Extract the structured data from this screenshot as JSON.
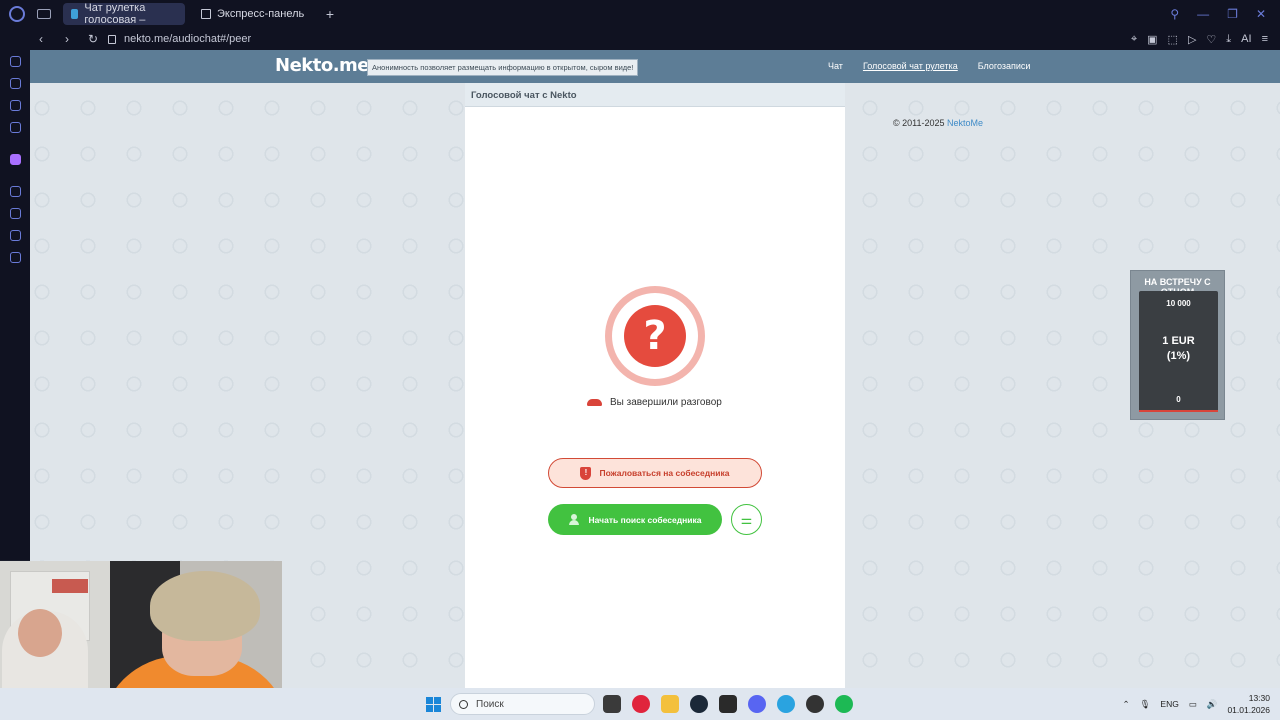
{
  "browser": {
    "tabs": [
      {
        "label": "Чат рулетка голосовая –",
        "active": true
      },
      {
        "label": "Экспресс-панель",
        "active": false
      }
    ],
    "new_tab": "+",
    "url": "nekto.me/audiochat#/peer",
    "ai_label": "AI"
  },
  "site": {
    "logo": "Nekto.me",
    "slogan": "Анонимность позволяет размещать информацию в открытом, сыром виде!",
    "nav": [
      "Чат",
      "Голосовой чат рулетка",
      "Блогозаписи"
    ],
    "copyright_prefix": "© 2011-2025 ",
    "copyright_link": "NektoMe"
  },
  "chat": {
    "header": "Голосовой чат с Nekto",
    "status_symbol": "?",
    "end_message": "Вы завершили разговор",
    "report_label": "Пожаловаться на собеседника",
    "search_label": "Начать поиск собеседника",
    "settings_icon": "sliders-icon"
  },
  "donation": {
    "title": "НА ВСТРЕЧУ С ОТЦОМ",
    "goal": "10 000",
    "amount_line1": "1 EUR",
    "amount_line2": "(1%)",
    "min": "0",
    "progress_percent": 1
  },
  "taskbar": {
    "search_placeholder": "Поиск",
    "lang": "ENG",
    "time": "13:30",
    "date": "01.01.2026"
  },
  "colors": {
    "header": "#5d7d96",
    "accent_red": "#e54b3e",
    "accent_green": "#42c240",
    "link": "#3f8bc7"
  }
}
